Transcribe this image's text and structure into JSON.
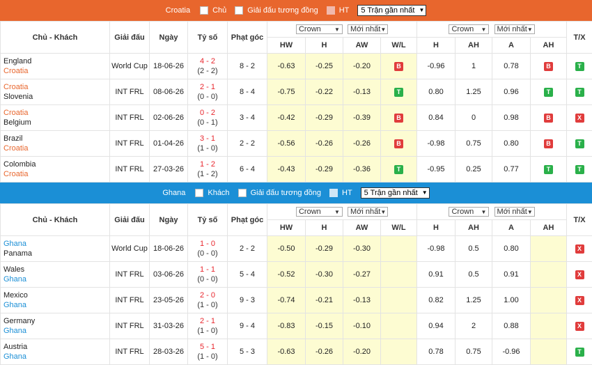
{
  "section1": {
    "team": "Croatia",
    "checkbox_home": "Chủ",
    "checkbox_same": "Giải đấu tương đồng",
    "checkbox_ht": "HT",
    "select_value": "5 Trận gần nhất",
    "colors": {
      "bar": "#e8662d",
      "team_text": "#e8662d"
    }
  },
  "section2": {
    "team": "Ghana",
    "checkbox_home": "Khách",
    "checkbox_same": "Giải đấu tương đồng",
    "checkbox_ht": "HT",
    "select_value": "5 Trận gần nhất",
    "colors": {
      "bar": "#1b8fd6",
      "team_text": "#1b8fd6"
    }
  },
  "headers": {
    "match": "Chủ - Khách",
    "league": "Giải đấu",
    "date": "Ngày",
    "score": "Tỷ số",
    "corner": "Phạt góc",
    "bookmaker1": "Crown",
    "sort1": "Mới nhất",
    "bookmaker2": "Crown",
    "sort2": "Mới nhất",
    "tx": "T/X",
    "hw": "HW",
    "h": "H",
    "aw": "AW",
    "wl": "W/L",
    "h2": "H",
    "ah": "AH",
    "a": "A",
    "ah2": "AH"
  },
  "rows1": [
    {
      "home": "England",
      "away": "Croatia",
      "league": "World Cup",
      "date": "18-06-26",
      "score": "4 - 2",
      "ht": "(2 - 2)",
      "corner": "8 - 2",
      "hw": "-0.63",
      "h": "-0.25",
      "aw": "-0.20",
      "wl": "B",
      "h2": "-0.96",
      "ah": "1",
      "a": "0.78",
      "ah_res": "B",
      "tx": "T"
    },
    {
      "home": "Croatia",
      "away": "Slovenia",
      "league": "INT FRL",
      "date": "08-06-26",
      "score": "2 - 1",
      "ht": "(0 - 0)",
      "corner": "8 - 4",
      "hw": "-0.75",
      "h": "-0.22",
      "aw": "-0.13",
      "wl": "T",
      "h2": "0.80",
      "ah": "1.25",
      "a": "0.96",
      "ah_res": "T",
      "tx": "T"
    },
    {
      "home": "Croatia",
      "away": "Belgium",
      "league": "INT FRL",
      "date": "02-06-26",
      "score": "0 - 2",
      "ht": "(0 - 1)",
      "corner": "3 - 4",
      "hw": "-0.42",
      "h": "-0.29",
      "aw": "-0.39",
      "wl": "B",
      "h2": "0.84",
      "ah": "0",
      "a": "0.98",
      "ah_res": "B",
      "tx": "X"
    },
    {
      "home": "Brazil",
      "away": "Croatia",
      "league": "INT FRL",
      "date": "01-04-26",
      "score": "3 - 1",
      "ht": "(1 - 0)",
      "corner": "2 - 2",
      "hw": "-0.56",
      "h": "-0.26",
      "aw": "-0.26",
      "wl": "B",
      "h2": "-0.98",
      "ah": "0.75",
      "a": "0.80",
      "ah_res": "B",
      "tx": "T"
    },
    {
      "home": "Colombia",
      "away": "Croatia",
      "league": "INT FRL",
      "date": "27-03-26",
      "score": "1 - 2",
      "ht": "(1 - 2)",
      "corner": "6 - 4",
      "hw": "-0.43",
      "h": "-0.29",
      "aw": "-0.36",
      "wl": "T",
      "h2": "-0.95",
      "ah": "0.25",
      "a": "0.77",
      "ah_res": "T",
      "tx": "T"
    }
  ],
  "rows2": [
    {
      "home": "Ghana",
      "away": "Panama",
      "league": "World Cup",
      "date": "18-06-26",
      "score": "1 - 0",
      "ht": "(0 - 0)",
      "corner": "2 - 2",
      "hw": "-0.50",
      "h": "-0.29",
      "aw": "-0.30",
      "wl": "",
      "h2": "-0.98",
      "ah": "0.5",
      "a": "0.80",
      "ah_res": "",
      "tx": "X"
    },
    {
      "home": "Wales",
      "away": "Ghana",
      "league": "INT FRL",
      "date": "03-06-26",
      "score": "1 - 1",
      "ht": "(0 - 0)",
      "corner": "5 - 4",
      "hw": "-0.52",
      "h": "-0.30",
      "aw": "-0.27",
      "wl": "",
      "h2": "0.91",
      "ah": "0.5",
      "a": "0.91",
      "ah_res": "",
      "tx": "X"
    },
    {
      "home": "Mexico",
      "away": "Ghana",
      "league": "INT FRL",
      "date": "23-05-26",
      "score": "2 - 0",
      "ht": "(1 - 0)",
      "corner": "9 - 3",
      "hw": "-0.74",
      "h": "-0.21",
      "aw": "-0.13",
      "wl": "",
      "h2": "0.82",
      "ah": "1.25",
      "a": "1.00",
      "ah_res": "",
      "tx": "X"
    },
    {
      "home": "Germany",
      "away": "Ghana",
      "league": "INT FRL",
      "date": "31-03-26",
      "score": "2 - 1",
      "ht": "(1 - 0)",
      "corner": "9 - 4",
      "hw": "-0.83",
      "h": "-0.15",
      "aw": "-0.10",
      "wl": "",
      "h2": "0.94",
      "ah": "2",
      "a": "0.88",
      "ah_res": "",
      "tx": "X"
    },
    {
      "home": "Austria",
      "away": "Ghana",
      "league": "INT FRL",
      "date": "28-03-26",
      "score": "5 - 1",
      "ht": "(1 - 0)",
      "corner": "5 - 3",
      "hw": "-0.63",
      "h": "-0.26",
      "aw": "-0.20",
      "wl": "",
      "h2": "0.78",
      "ah": "0.75",
      "a": "-0.96",
      "ah_res": "",
      "tx": "T"
    }
  ]
}
